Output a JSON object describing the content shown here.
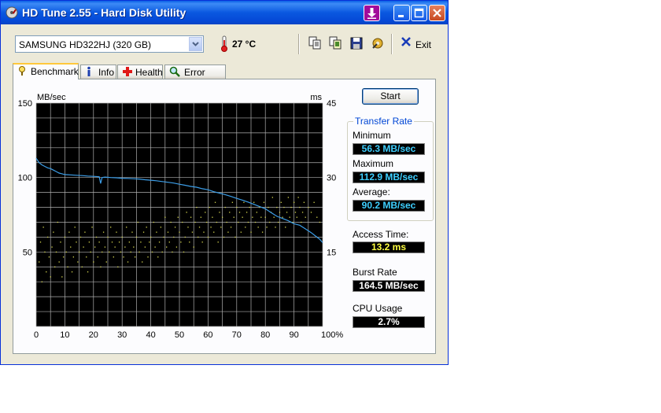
{
  "window": {
    "title": "HD Tune 2.55 - Hard Disk Utility"
  },
  "toolbar": {
    "drive": "SAMSUNG HD322HJ (320 GB)",
    "temperature": "27 °C",
    "exit_label": "Exit",
    "icons": [
      "copy-icon",
      "copy-info-icon",
      "save-icon",
      "options-icon",
      "exit-icon"
    ]
  },
  "tabs": [
    {
      "label": "Benchmark",
      "icon": "benchmark-icon",
      "active": true
    },
    {
      "label": "Info",
      "icon": "info-icon",
      "active": false
    },
    {
      "label": "Health",
      "icon": "health-icon",
      "active": false
    },
    {
      "label": "Error Scan",
      "icon": "error-scan-icon",
      "active": false
    }
  ],
  "benchmark": {
    "start_label": "Start",
    "transfer_rate_title": "Transfer Rate",
    "minimum_label": "Minimum",
    "minimum_value": "56.3 MB/sec",
    "maximum_label": "Maximum",
    "maximum_value": "112.9 MB/sec",
    "average_label": "Average:",
    "average_value": "90.2 MB/sec",
    "access_time_label": "Access Time:",
    "access_time_value": "13.2 ms",
    "burst_rate_label": "Burst Rate",
    "burst_rate_value": "164.5 MB/sec",
    "cpu_usage_label": "CPU Usage",
    "cpu_usage_value": "2.7%"
  },
  "colors": {
    "transfer_line": "#3c9ee8",
    "access_dots": "#d8d850",
    "plot_bg": "#000000",
    "grid": "#b0b0b0",
    "value_cyan": "#3ecfff",
    "value_yellow": "#ffff40"
  },
  "chart_data": {
    "type": "line",
    "ylabel": "MB/sec",
    "y2label": "ms",
    "x_ticks": [
      "0",
      "10",
      "20",
      "30",
      "40",
      "50",
      "60",
      "70",
      "80",
      "90",
      "100%"
    ],
    "y_ticks": [
      "150",
      "100",
      "50"
    ],
    "y2_ticks": [
      "45",
      "30",
      "15"
    ],
    "xlim": [
      0,
      100
    ],
    "ylim": [
      0,
      150
    ],
    "y2lim": [
      0,
      45
    ],
    "grid": true,
    "series": [
      {
        "kind": "line",
        "x": [
          0,
          1,
          2,
          3,
          4,
          5,
          6,
          7,
          8,
          9,
          10,
          12,
          14,
          16,
          18,
          20,
          22,
          22.5,
          23,
          24,
          26,
          28,
          30,
          32,
          34,
          36,
          38,
          40,
          42,
          44,
          46,
          48,
          50,
          52,
          54,
          56,
          58,
          60,
          62,
          64,
          66,
          68,
          70,
          72,
          74,
          76,
          78,
          80,
          82,
          84,
          86,
          88,
          90,
          92,
          94,
          96,
          98,
          99,
          100
        ],
        "values": [
          112.9,
          110,
          108.5,
          107.5,
          106.5,
          106,
          105,
          104,
          103,
          102.5,
          102,
          101.8,
          101.5,
          101.3,
          101,
          100.8,
          100.5,
          96,
          100,
          100.3,
          100,
          99.8,
          99.5,
          99.4,
          99.2,
          99,
          98.5,
          98.2,
          97.8,
          97.3,
          96.8,
          96.3,
          95.5,
          94.8,
          94,
          93.5,
          92.5,
          91.8,
          90.5,
          89.5,
          88.5,
          87.3,
          86,
          84.8,
          83.5,
          82,
          80.5,
          79,
          76.5,
          74,
          72.5,
          71,
          69,
          68,
          65.5,
          63,
          60,
          58.5,
          56.3
        ]
      },
      {
        "kind": "scatter",
        "name": "",
        "points": [
          [
            1,
            13
          ],
          [
            1.5,
            17
          ],
          [
            2,
            9
          ],
          [
            2.5,
            20
          ],
          [
            3,
            15
          ],
          [
            3.5,
            11
          ],
          [
            4,
            18
          ],
          [
            4.5,
            14
          ],
          [
            5,
            10
          ],
          [
            5.5,
            16
          ],
          [
            6,
            19
          ],
          [
            6.5,
            12
          ],
          [
            7,
            15
          ],
          [
            7.5,
            21
          ],
          [
            8,
            13
          ],
          [
            8.5,
            17
          ],
          [
            9,
            10
          ],
          [
            9.5,
            14
          ],
          [
            10,
            18
          ],
          [
            10.5,
            15
          ],
          [
            11,
            12
          ],
          [
            11.5,
            19
          ],
          [
            12,
            16
          ],
          [
            12.5,
            11
          ],
          [
            13,
            14
          ],
          [
            13.5,
            20
          ],
          [
            14,
            17
          ],
          [
            14.5,
            13
          ],
          [
            15,
            15
          ],
          [
            15.5,
            18
          ],
          [
            16,
            12
          ],
          [
            16.5,
            16
          ],
          [
            17,
            19
          ],
          [
            17.5,
            14
          ],
          [
            18,
            11
          ],
          [
            18.5,
            17
          ],
          [
            19,
            15
          ],
          [
            19.5,
            20
          ],
          [
            20,
            13
          ],
          [
            20.5,
            16
          ],
          [
            21,
            18
          ],
          [
            21.5,
            14
          ],
          [
            22,
            17
          ],
          [
            22.5,
            12
          ],
          [
            23,
            15
          ],
          [
            23.5,
            19
          ],
          [
            24,
            16
          ],
          [
            24.5,
            13
          ],
          [
            25,
            18
          ],
          [
            25.5,
            15
          ],
          [
            26,
            20
          ],
          [
            26.5,
            17
          ],
          [
            27,
            14
          ],
          [
            27.5,
            16
          ],
          [
            28,
            19
          ],
          [
            28.5,
            12
          ],
          [
            29,
            17
          ],
          [
            29.5,
            15
          ],
          [
            30,
            18
          ],
          [
            30.5,
            14
          ],
          [
            31,
            16
          ],
          [
            31.5,
            20
          ],
          [
            32,
            13
          ],
          [
            32.5,
            17
          ],
          [
            33,
            15
          ],
          [
            33.5,
            19
          ],
          [
            34,
            16
          ],
          [
            34.5,
            14
          ],
          [
            35,
            18
          ],
          [
            35.5,
            21
          ],
          [
            36,
            15
          ],
          [
            36.5,
            17
          ],
          [
            37,
            13
          ],
          [
            37.5,
            19
          ],
          [
            38,
            16
          ],
          [
            38.5,
            20
          ],
          [
            39,
            14
          ],
          [
            39.5,
            17
          ],
          [
            40,
            18
          ],
          [
            40.5,
            15
          ],
          [
            41,
            21
          ],
          [
            41.5,
            16
          ],
          [
            42,
            19
          ],
          [
            42.5,
            14
          ],
          [
            43,
            17
          ],
          [
            43.5,
            20
          ],
          [
            44,
            15
          ],
          [
            44.5,
            18
          ],
          [
            45,
            22
          ],
          [
            45.5,
            16
          ],
          [
            46,
            19
          ],
          [
            46.5,
            17
          ],
          [
            47,
            21
          ],
          [
            47.5,
            15
          ],
          [
            48,
            18
          ],
          [
            48.5,
            20
          ],
          [
            49,
            16
          ],
          [
            49.5,
            22
          ],
          [
            50,
            19
          ],
          [
            50.5,
            17
          ],
          [
            51,
            21
          ],
          [
            51.5,
            15
          ],
          [
            52,
            18
          ],
          [
            52.5,
            23
          ],
          [
            53,
            20
          ],
          [
            53.5,
            17
          ],
          [
            54,
            22
          ],
          [
            54.5,
            19
          ],
          [
            55,
            16
          ],
          [
            55.5,
            21
          ],
          [
            56,
            24
          ],
          [
            56.5,
            18
          ],
          [
            57,
            20
          ],
          [
            57.5,
            22
          ],
          [
            58,
            17
          ],
          [
            58.5,
            19
          ],
          [
            59,
            23
          ],
          [
            59.5,
            21
          ],
          [
            60,
            18
          ],
          [
            60.5,
            24
          ],
          [
            61,
            20
          ],
          [
            61.5,
            22
          ],
          [
            62,
            19
          ],
          [
            62.5,
            25
          ],
          [
            63,
            21
          ],
          [
            63.5,
            17
          ],
          [
            64,
            23
          ],
          [
            64.5,
            20
          ],
          [
            65,
            22
          ],
          [
            65.5,
            18
          ],
          [
            66,
            24
          ],
          [
            66.5,
            21
          ],
          [
            67,
            19
          ],
          [
            67.5,
            23
          ],
          [
            68,
            20
          ],
          [
            68.5,
            25
          ],
          [
            69,
            22
          ],
          [
            69.5,
            18
          ],
          [
            70,
            24
          ],
          [
            70.5,
            21
          ],
          [
            71,
            23
          ],
          [
            71.5,
            19
          ],
          [
            72,
            22
          ],
          [
            72.5,
            25
          ],
          [
            73,
            20
          ],
          [
            73.5,
            23
          ],
          [
            74,
            21
          ],
          [
            74.5,
            24
          ],
          [
            75,
            19
          ],
          [
            75.5,
            22
          ],
          [
            76,
            25
          ],
          [
            76.5,
            21
          ],
          [
            77,
            23
          ],
          [
            77.5,
            20
          ],
          [
            78,
            24
          ],
          [
            78.5,
            22
          ],
          [
            79,
            19
          ],
          [
            79.5,
            25
          ],
          [
            80,
            22
          ],
          [
            80.5,
            20
          ],
          [
            81,
            24
          ],
          [
            81.5,
            21
          ],
          [
            82,
            23
          ],
          [
            82.5,
            26
          ],
          [
            83,
            22
          ],
          [
            83.5,
            20
          ],
          [
            84,
            24
          ],
          [
            84.5,
            21
          ],
          [
            85,
            23
          ],
          [
            85.5,
            25
          ],
          [
            86,
            22
          ],
          [
            86.5,
            24
          ],
          [
            87,
            20
          ],
          [
            87.5,
            23
          ],
          [
            88,
            26
          ],
          [
            88.5,
            22
          ],
          [
            89,
            24
          ],
          [
            89.5,
            21
          ],
          [
            90,
            25
          ],
          [
            90.5,
            23
          ],
          [
            91,
            22
          ],
          [
            91.5,
            26
          ],
          [
            92,
            24
          ],
          [
            92.5,
            21
          ],
          [
            93,
            23
          ],
          [
            93.5,
            25
          ],
          [
            94,
            22
          ],
          [
            95,
            24
          ],
          [
            96,
            23
          ],
          [
            97,
            25
          ],
          [
            98,
            22
          ],
          [
            99,
            21
          ]
        ]
      }
    ]
  }
}
